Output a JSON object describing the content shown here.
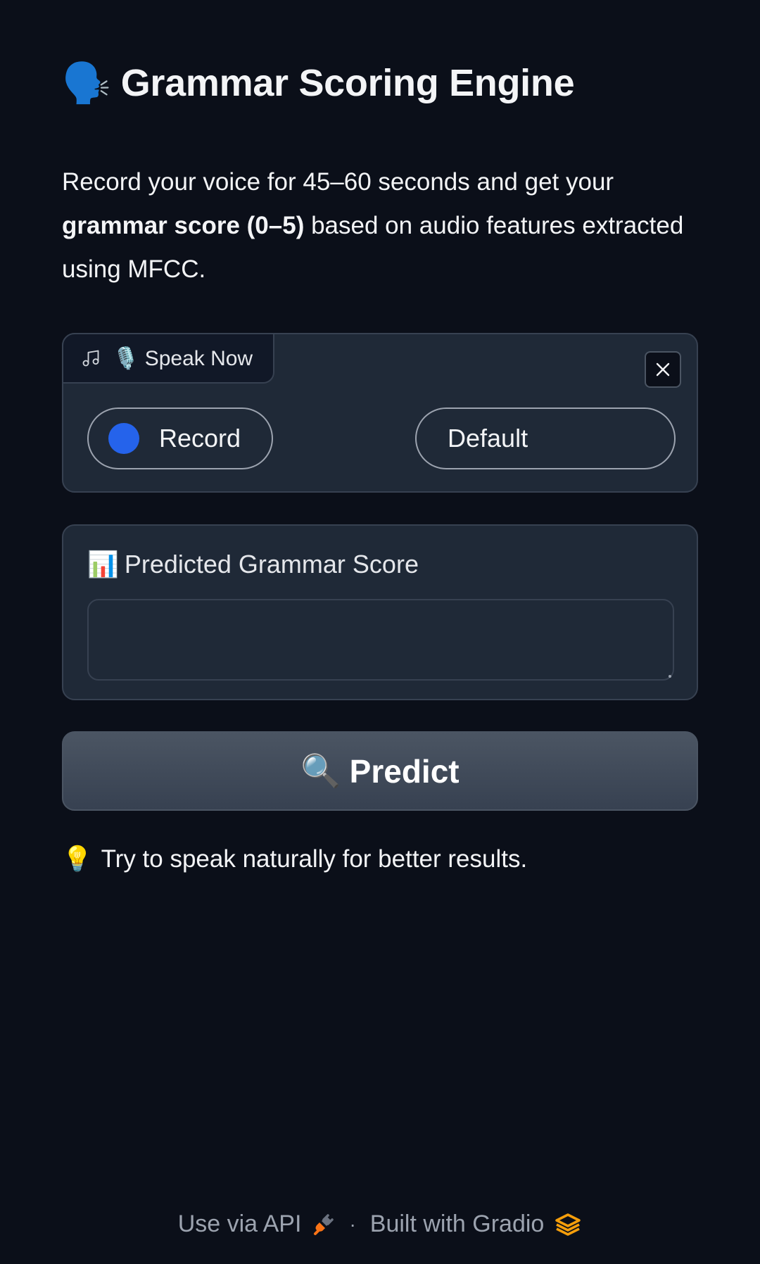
{
  "header": {
    "emoji": "🗣️",
    "title": "Grammar Scoring Engine"
  },
  "description": {
    "part1": "Record your voice for 45–60 seconds and get your ",
    "bold": "grammar score (0–5)",
    "part2": " based on audio features extracted using MFCC."
  },
  "audio_input": {
    "icon": "music-note-icon",
    "label": "🎙️ Speak Now",
    "record_label": "Record",
    "device_value": "Default",
    "close_icon": "close-icon"
  },
  "output": {
    "emoji": "📊",
    "label": "Predicted Grammar Score",
    "value": ""
  },
  "predict_button": {
    "emoji": "🔍",
    "label": "Predict"
  },
  "tip": {
    "emoji": "💡",
    "text": "Try to speak naturally for better results."
  },
  "footer": {
    "api_label": "Use via API",
    "separator": "·",
    "built_label": "Built with Gradio"
  },
  "colors": {
    "background": "#0b0f19",
    "panel": "#1f2937",
    "record_dot": "#2563eb",
    "api_icon": "#f97316",
    "gradio_logo": "#f59e0b"
  }
}
